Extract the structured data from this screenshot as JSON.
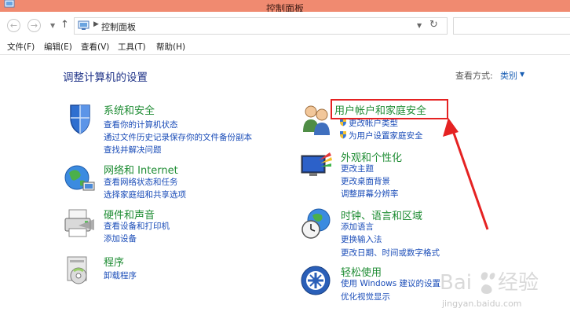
{
  "window": {
    "title": "控制面板"
  },
  "address": {
    "path": "控制面板"
  },
  "menu": [
    "文件(F)",
    "编辑(E)",
    "查看(V)",
    "工具(T)",
    "帮助(H)"
  ],
  "page": {
    "title": "调整计算机的设置",
    "view_label": "查看方式:",
    "view_value": "类别"
  },
  "categories_left": [
    {
      "name": "系统和安全",
      "links": [
        "查看你的计算机状态",
        "通过文件历史记录保存你的文件备份副本",
        "查找并解决问题"
      ]
    },
    {
      "name": "网络和 Internet",
      "links": [
        "查看网络状态和任务",
        "选择家庭组和共享选项"
      ]
    },
    {
      "name": "硬件和声音",
      "links": [
        "查看设备和打印机",
        "添加设备"
      ]
    },
    {
      "name": "程序",
      "links": [
        "卸载程序"
      ]
    }
  ],
  "categories_right": [
    {
      "name": "用户帐户和家庭安全",
      "links": [
        "更改帐户类型",
        "为用户设置家庭安全"
      ]
    },
    {
      "name": "外观和个性化",
      "links": [
        "更改主题",
        "更改桌面背景",
        "调整屏幕分辨率"
      ]
    },
    {
      "name": "时钟、语言和区域",
      "links": [
        "添加语言",
        "更换输入法",
        "更改日期、时间或数字格式"
      ]
    },
    {
      "name": "轻松使用",
      "links": [
        "使用 Windows 建议的设置",
        "优化视觉显示"
      ]
    }
  ],
  "watermark": {
    "text": "jingyan.baidu.com"
  },
  "colors": {
    "titlebar": "#f08a70",
    "heading": "#1e8c33",
    "link": "#1a4cb8",
    "annotation": "#e52222"
  }
}
